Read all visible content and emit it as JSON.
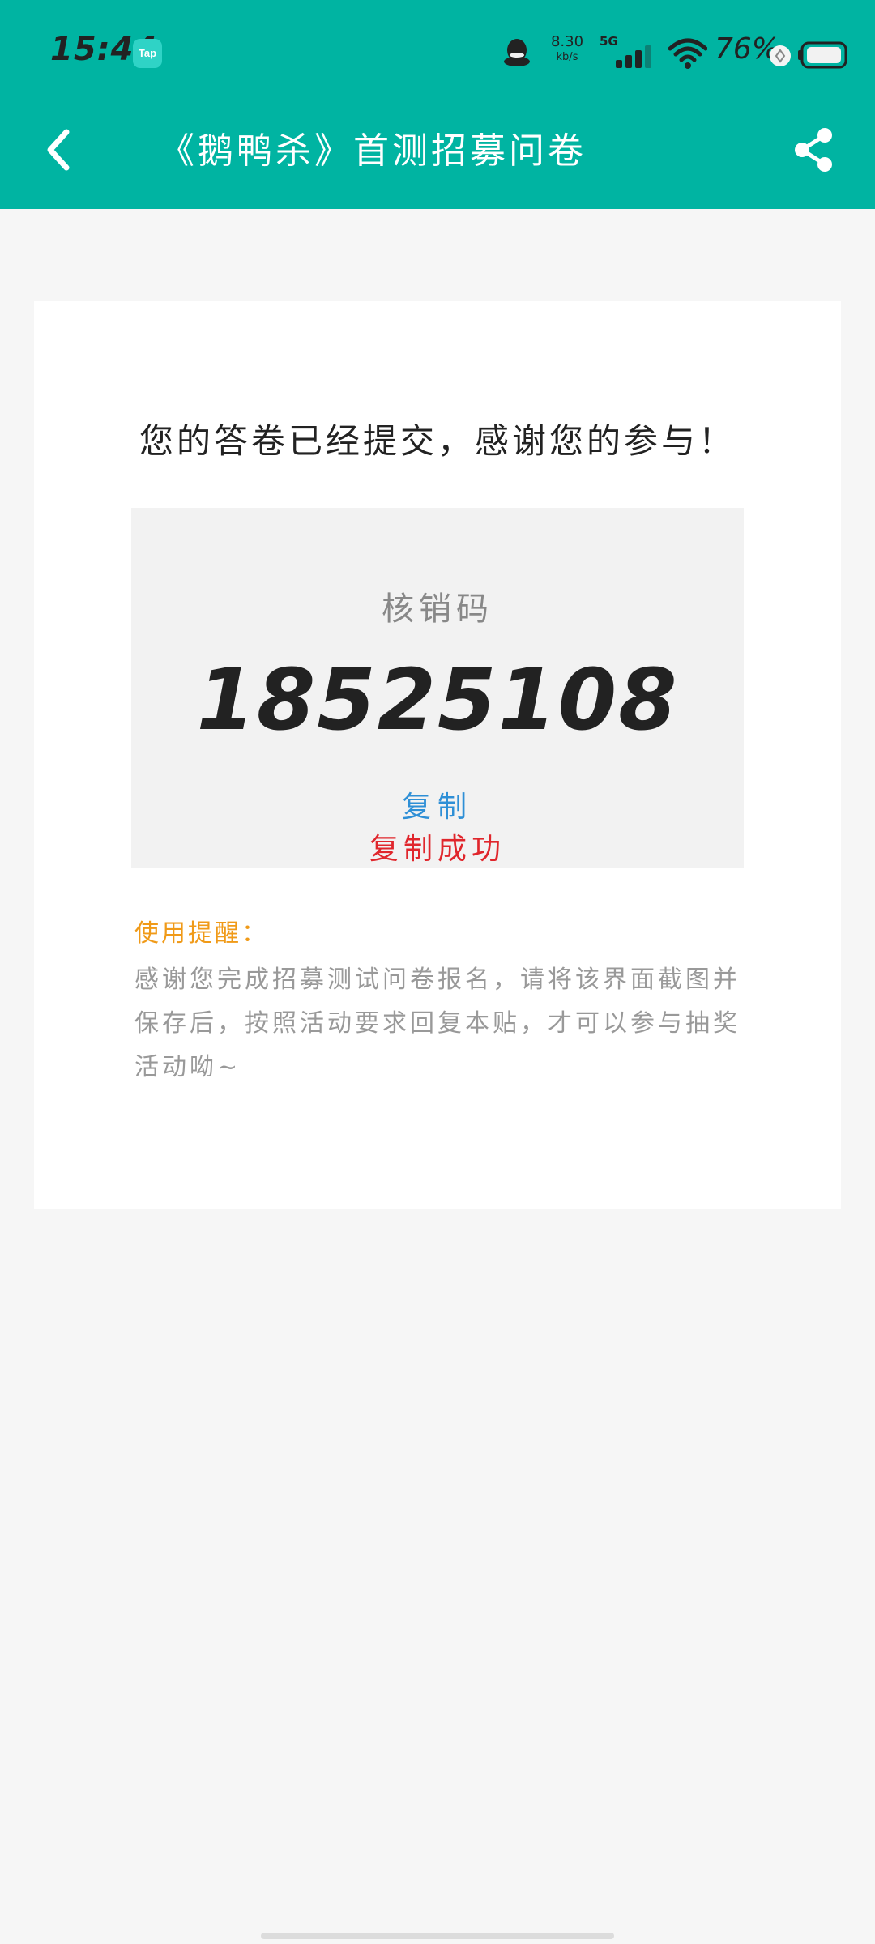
{
  "status_bar": {
    "time": "15:44",
    "app_badge": "Tap",
    "net_speed_value": "8.30",
    "net_speed_unit": "kb/s",
    "network_type": "5G",
    "battery_percent": "76%"
  },
  "header": {
    "title": "《鹅鸭杀》首测招募问卷",
    "back_icon": "chevron-left-icon",
    "share_icon": "share-icon",
    "bg_color": "#00b4a2"
  },
  "card": {
    "thanks_message": "您的答卷已经提交，感谢您的参与！",
    "code_label": "核销码",
    "code_value": "18525108",
    "copy_label": "复制",
    "copy_status": "复制成功",
    "tip_title": "使用提醒：",
    "tip_body": "感谢您完成招募测试问卷报名，请将该界面截图并保存后，按照活动要求回复本贴，才可以参与抽奖活动呦~"
  },
  "colors": {
    "copy_link": "#2e8fd6",
    "copy_success": "#e0262c",
    "tip_title": "#f09a18"
  }
}
